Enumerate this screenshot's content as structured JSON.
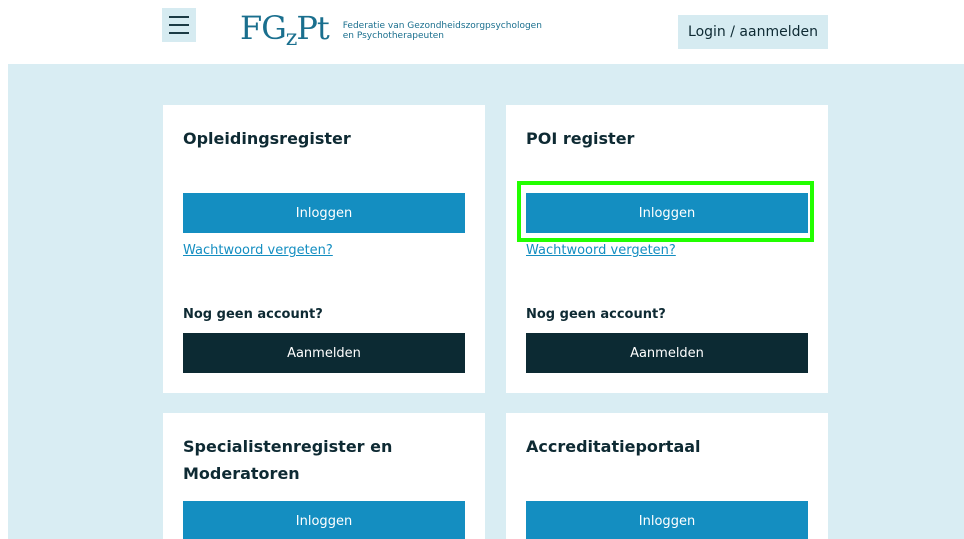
{
  "header": {
    "menu_icon": "hamburger-menu-icon",
    "logo_mark": "FGzPt",
    "logo_line1": "Federatie van Gezondheidszorgpsychologen",
    "logo_line2": "en Psychotherapeuten",
    "login_label": "Login / aanmelden",
    "colors": {
      "accent": "#148ec1",
      "dark": "#0c2a33",
      "background": "#d9edf3",
      "highlight": "#22ff00"
    }
  },
  "cards": [
    {
      "title": "Opleidingsregister",
      "login_label": "Inloggen",
      "forgot_label": "Wachtwoord vergeten?",
      "no_account_label": "Nog geen account?",
      "register_label": "Aanmelden"
    },
    {
      "title": "POI register",
      "login_label": "Inloggen",
      "forgot_label": "Wachtwoord vergeten?",
      "no_account_label": "Nog geen account?",
      "register_label": "Aanmelden"
    },
    {
      "title_line1": "Specialistenregister en",
      "title_line2": "Moderatoren",
      "login_label": "Inloggen"
    },
    {
      "title": "Accreditatieportaal",
      "login_label": "Inloggen"
    }
  ]
}
